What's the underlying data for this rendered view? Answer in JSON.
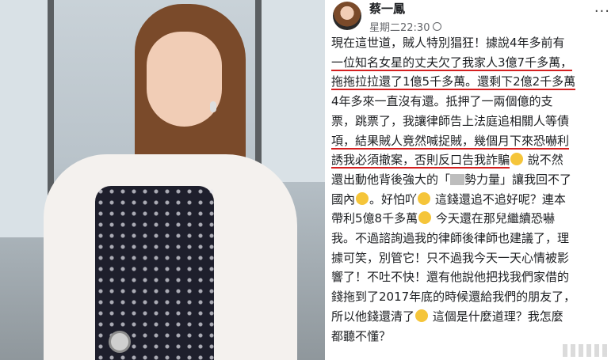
{
  "post": {
    "author": "蔡一鳳",
    "time": "星期二22:30",
    "lines": [
      "現在這世道，賊人特別猖狂！據說4年多前有",
      "一位知名女星的丈夫欠了我家人3億7千多萬，",
      "拖拖拉拉還了1億5千多萬。還剩下2億2千多萬",
      "4年多來一直沒有還。抵押了一兩個億的支",
      "票，跳票了，我讓律師告上法庭追相關人等債",
      "項，結果賊人竟然喊捉賊，幾個月下來恐嚇利",
      "誘我必須撤案，否則反口告我詐騙",
      "說不然",
      "還出動他背後強大的「",
      "勢力量」讓我回不了",
      "國內",
      "。好怕吖",
      "這錢還追不追好呢？連本",
      "帶利5億8千多萬",
      "今天還在那兒繼續恐嚇",
      "我。不過諮詢過我的律師後律師也建議了，理",
      "據可笑，別管它！只不過我今天一天心情被影",
      "響了！不吐不快！還有他說他把找我們家借的",
      "錢拖到了2017年底的時候還給我們的朋友了，",
      "所以他錢還清了",
      "這個是什麼道理？我怎麼",
      "都聽不懂？"
    ]
  },
  "icons": {
    "globe": "globe-icon",
    "more": "more-options-icon",
    "emoji": "laughing-emoji-icon"
  },
  "colors": {
    "underline": "#d42020",
    "meta_text": "#65676b"
  }
}
